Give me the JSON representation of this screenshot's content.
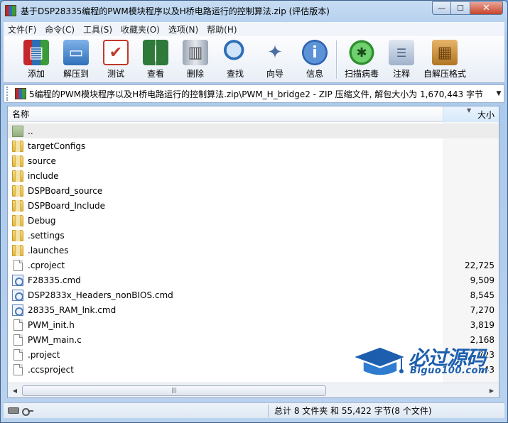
{
  "window": {
    "title": "基于DSP28335编程的PWM模块程序以及H桥电路运行的控制算法.zip (评估版本)",
    "min_label": "—",
    "max_label": "☐",
    "close_label": "✕"
  },
  "menu": [
    "文件(F)",
    "命令(C)",
    "工具(S)",
    "收藏夹(O)",
    "选项(N)",
    "帮助(H)"
  ],
  "toolbar": [
    {
      "label": "添加",
      "icon": "add-archive-icon",
      "color": "#b8342b"
    },
    {
      "label": "解压到",
      "icon": "extract-folder-icon",
      "color": "#3b7cc4"
    },
    {
      "label": "测试",
      "icon": "test-clipboard-icon",
      "color": "#c0392b"
    },
    {
      "label": "查看",
      "icon": "view-book-icon",
      "color": "#2f7a3a"
    },
    {
      "label": "删除",
      "icon": "delete-trash-icon",
      "color": "#7a8796"
    },
    {
      "label": "查找",
      "icon": "find-magnifier-icon",
      "color": "#2d6fb8"
    },
    {
      "label": "向导",
      "icon": "wizard-wand-icon",
      "color": "#4a6fa5"
    },
    {
      "label": "信息",
      "icon": "info-icon",
      "color": "#2e64b2"
    },
    {
      "label": "扫描病毒",
      "icon": "virus-scan-bug-icon",
      "color": "#2f8f2f"
    },
    {
      "label": "注释",
      "icon": "comment-icon",
      "color": "#6d87a8"
    },
    {
      "label": "自解压格式",
      "icon": "sfx-box-icon",
      "color": "#c0872f"
    }
  ],
  "address": {
    "path": "5编程的PWM模块程序以及H桥电路运行的控制算法.zip\\PWM_H_bridge2 - ZIP 压缩文件, 解包大小为 1,670,443 字节"
  },
  "columns": {
    "name": "名称",
    "size": "大小"
  },
  "files": [
    {
      "name": "..",
      "size": "",
      "type": "up"
    },
    {
      "name": "targetConfigs",
      "size": "",
      "type": "folder"
    },
    {
      "name": "source",
      "size": "",
      "type": "folder"
    },
    {
      "name": "include",
      "size": "",
      "type": "folder"
    },
    {
      "name": "DSPBoard_source",
      "size": "",
      "type": "folder"
    },
    {
      "name": "DSPBoard_Include",
      "size": "",
      "type": "folder"
    },
    {
      "name": "Debug",
      "size": "",
      "type": "folder"
    },
    {
      "name": ".settings",
      "size": "",
      "type": "folder"
    },
    {
      "name": ".launches",
      "size": "",
      "type": "folder"
    },
    {
      "name": ".cproject",
      "size": "22,725",
      "type": "doc"
    },
    {
      "name": "F28335.cmd",
      "size": "9,509",
      "type": "cmd"
    },
    {
      "name": "DSP2833x_Headers_nonBIOS.cmd",
      "size": "8,545",
      "type": "cmd"
    },
    {
      "name": "28335_RAM_lnk.cmd",
      "size": "7,270",
      "type": "cmd"
    },
    {
      "name": "PWM_init.h",
      "size": "3,819",
      "type": "doc"
    },
    {
      "name": "PWM_main.c",
      "size": "2,168",
      "type": "doc"
    },
    {
      "name": ".project",
      "size": "723",
      "type": "doc"
    },
    {
      "name": ".ccsproject",
      "size": "543",
      "type": "doc"
    }
  ],
  "status": {
    "summary": "总计 8 文件夹 和 55,422 字节(8 个文件)"
  },
  "watermark": {
    "cn": "必过源码",
    "en": "Biguo100.com"
  }
}
